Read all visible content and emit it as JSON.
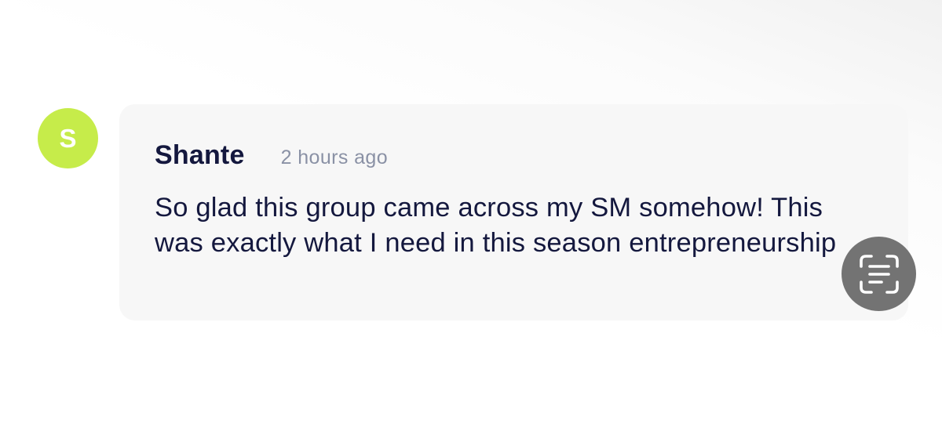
{
  "comment": {
    "avatar_letter": "S",
    "author": "Shante",
    "timestamp": "2 hours ago",
    "message": "So glad this group came across my SM somehow! This was exactly what I need in this season entrepreneurship"
  },
  "overlay": {
    "icon": "live-text-scan-icon"
  },
  "colors": {
    "avatar_bg": "#c6ec4a",
    "text_primary": "#14183e",
    "text_muted": "#8a91a5",
    "bubble_bg": "#f7f7f7",
    "scan_button_bg": "#737373"
  }
}
